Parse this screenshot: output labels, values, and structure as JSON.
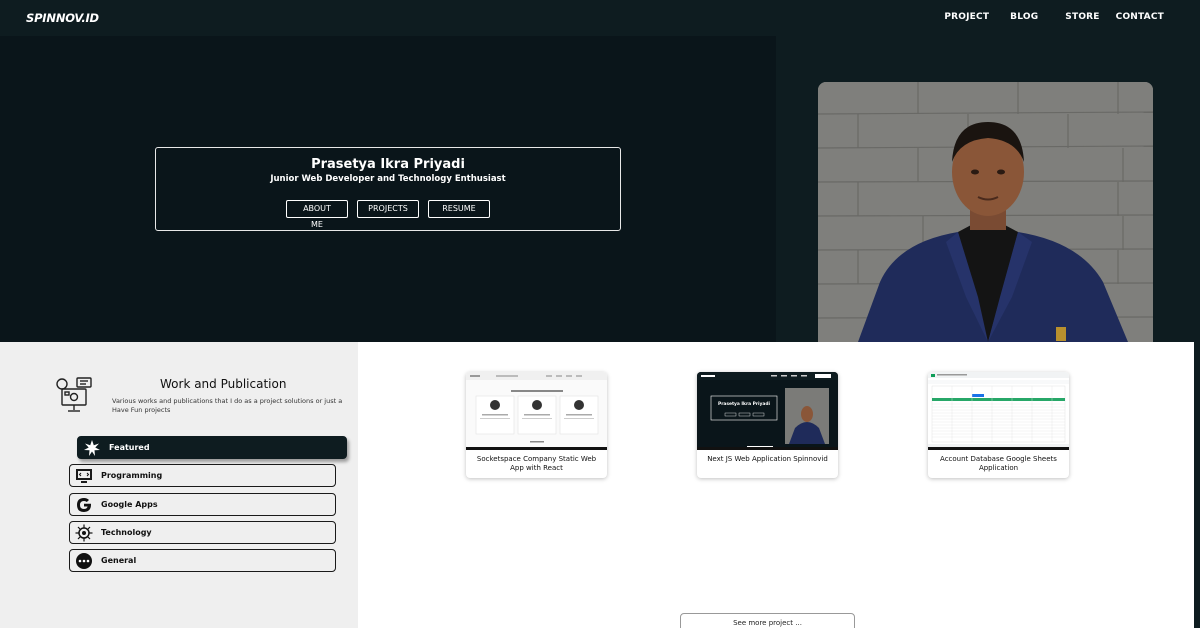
{
  "nav": {
    "logo": "SPINNOV.ID",
    "links": [
      "PROJECT",
      "BLOG",
      "STORE",
      "CONTACT"
    ]
  },
  "hero": {
    "name": "Prasetya Ikra Priyadi",
    "role": "Junior Web Developer and Technology Enthusiast",
    "buttons": [
      "ABOUT ME",
      "PROJECTS",
      "RESUME"
    ]
  },
  "work": {
    "title": "Work and Publication",
    "description": "Various works and publications that I do as a project solutions or just a Have Fun projects",
    "categories": [
      {
        "label": "Featured",
        "icon": "sparkle-icon",
        "active": true
      },
      {
        "label": "Programming",
        "icon": "code-window-icon",
        "active": false
      },
      {
        "label": "Google Apps",
        "icon": "google-icon",
        "active": false
      },
      {
        "label": "Technology",
        "icon": "chip-icon",
        "active": false
      },
      {
        "label": "General",
        "icon": "more-dots-icon",
        "active": false
      }
    ]
  },
  "projects": [
    {
      "title": "Socketspace Company Static Web App with React"
    },
    {
      "title": "Next JS Web Application Spinnovid",
      "thumb_name": "Prasetya Ikra Priyadi"
    },
    {
      "title": "Account Database Google Sheets Application"
    }
  ],
  "see_more": "See more project ...",
  "colors": {
    "dark": "#0e1c20",
    "hero_bg": "#0a151a",
    "panel": "#efefef"
  }
}
